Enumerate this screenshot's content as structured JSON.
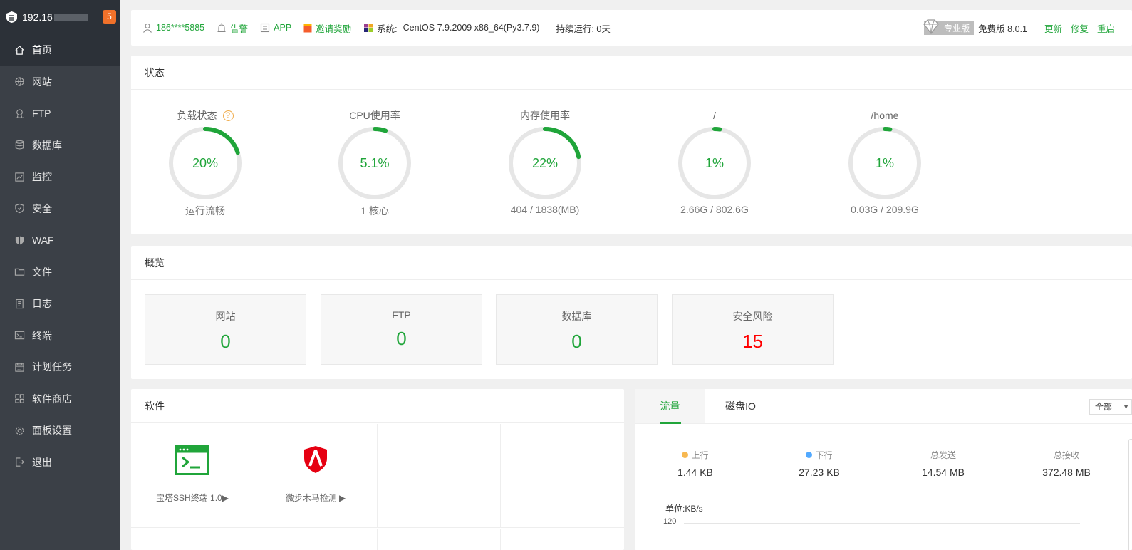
{
  "sidebar": {
    "host_ip": "192.16",
    "badge_count": "5",
    "items": [
      {
        "label": "首页",
        "icon": "home-icon"
      },
      {
        "label": "网站",
        "icon": "globe-icon"
      },
      {
        "label": "FTP",
        "icon": "ftp-icon"
      },
      {
        "label": "数据库",
        "icon": "database-icon"
      },
      {
        "label": "监控",
        "icon": "monitor-icon"
      },
      {
        "label": "安全",
        "icon": "shield-icon"
      },
      {
        "label": "WAF",
        "icon": "waf-shield-icon"
      },
      {
        "label": "文件",
        "icon": "folder-icon"
      },
      {
        "label": "日志",
        "icon": "log-icon"
      },
      {
        "label": "终端",
        "icon": "terminal-icon"
      },
      {
        "label": "计划任务",
        "icon": "calendar-icon"
      },
      {
        "label": "软件商店",
        "icon": "grid-icon"
      },
      {
        "label": "面板设置",
        "icon": "gear-icon"
      },
      {
        "label": "退出",
        "icon": "logout-icon"
      }
    ]
  },
  "topbar": {
    "user": "186****5885",
    "alarm": "告警",
    "app": "APP",
    "invite": "邀请奖励",
    "system_label": "系统:",
    "system_value": "CentOS 7.9.2009 x86_64(Py3.7.9)",
    "uptime": "持续运行: 0天",
    "pro_label": "专业版",
    "version": "免费版 8.0.1",
    "update": "更新",
    "repair": "修复",
    "restart": "重启"
  },
  "status": {
    "title": "状态",
    "gauges": [
      {
        "title": "负载状态",
        "value": "20%",
        "percent": 20,
        "sub": "运行流畅",
        "help": "?"
      },
      {
        "title": "CPU使用率",
        "value": "5.1%",
        "percent": 5.1,
        "sub": "1 核心"
      },
      {
        "title": "内存使用率",
        "value": "22%",
        "percent": 22,
        "sub": "404 / 1838(MB)"
      },
      {
        "title": "/",
        "value": "1%",
        "percent": 1,
        "sub": "2.66G / 802.6G"
      },
      {
        "title": "/home",
        "value": "1%",
        "percent": 1,
        "sub": "0.03G / 209.9G"
      }
    ]
  },
  "overview": {
    "title": "概览",
    "cards": [
      {
        "label": "网站",
        "value": "0"
      },
      {
        "label": "FTP",
        "value": "0"
      },
      {
        "label": "数据库",
        "value": "0"
      },
      {
        "label": "安全风险",
        "value": "15"
      }
    ]
  },
  "software": {
    "title": "软件",
    "items": [
      {
        "name": "宝塔SSH终端 1.0▶",
        "icon": "terminal-app-icon"
      },
      {
        "name": "微步木马检测 ▶",
        "icon": "trojan-shield-icon"
      }
    ]
  },
  "traffic": {
    "tabs": [
      "流量",
      "磁盘IO"
    ],
    "range": "全部",
    "stats": [
      {
        "label": "上行",
        "value": "1.44 KB",
        "dot": "#f7b851"
      },
      {
        "label": "下行",
        "value": "27.23 KB",
        "dot": "#52a9ff"
      },
      {
        "label": "总发送",
        "value": "14.54 MB"
      },
      {
        "label": "总接收",
        "value": "372.48 MB"
      }
    ],
    "unit": "单位:KB/s",
    "y_tick": "120"
  },
  "colors": {
    "accent": "#20a53a",
    "danger": "#ff0000",
    "sidebar_bg": "#3b4047"
  }
}
